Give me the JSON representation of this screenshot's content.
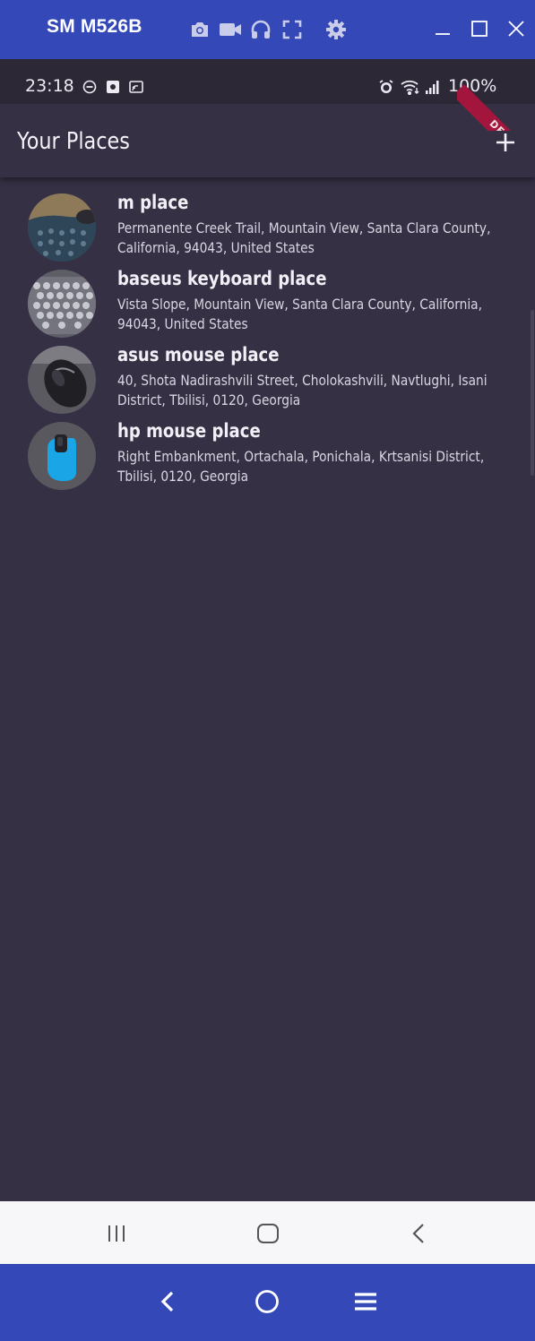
{
  "window": {
    "title": "SM M526B",
    "tools": [
      "camera-icon",
      "video-record-icon",
      "headphones-icon",
      "fullscreen-icon",
      "settings-gear-icon"
    ],
    "controls": [
      "minimize-icon",
      "maximize-icon",
      "close-icon"
    ]
  },
  "statusbar": {
    "time": "23:18",
    "battery": "100%",
    "left_icons": [
      "do-not-disturb-icon",
      "app-notification-icon",
      "cast-icon"
    ],
    "right_icons": [
      "alarm-icon",
      "wifi-icon",
      "signal-icon"
    ]
  },
  "debug_banner": "DEBUG",
  "appbar": {
    "title": "Your Places",
    "add_icon": "plus-icon"
  },
  "places": [
    {
      "name": "m place",
      "address": "Permanente Creek Trail, Mountain View, Santa Clara County, California, 94043, United States",
      "thumb": "mat-photo"
    },
    {
      "name": "baseus keyboard place",
      "address": "Vista Slope, Mountain View, Santa Clara County, California, 94043, United States",
      "thumb": "keyboard-photo"
    },
    {
      "name": "asus mouse place",
      "address": "40, Shota Nadirashvili Street, Cholokashvili, Navtlughi, Isani District, Tbilisi, 0120, Georgia",
      "thumb": "mouse-photo"
    },
    {
      "name": "hp mouse place",
      "address": "Right Embankment, Ortachala, Ponichala, Krtsanisi District, Tbilisi, 0120, Georgia",
      "thumb": "blue-mouse-photo"
    }
  ],
  "android_nav": [
    "recent-apps-icon",
    "home-icon",
    "back-icon"
  ],
  "host_nav": [
    "back-icon",
    "home-icon",
    "menu-icon"
  ],
  "colors": {
    "window_bar": "#3548b8",
    "app_background": "#363045",
    "status_bar": "#2c2836",
    "debug_ribbon": "#a3153c"
  }
}
